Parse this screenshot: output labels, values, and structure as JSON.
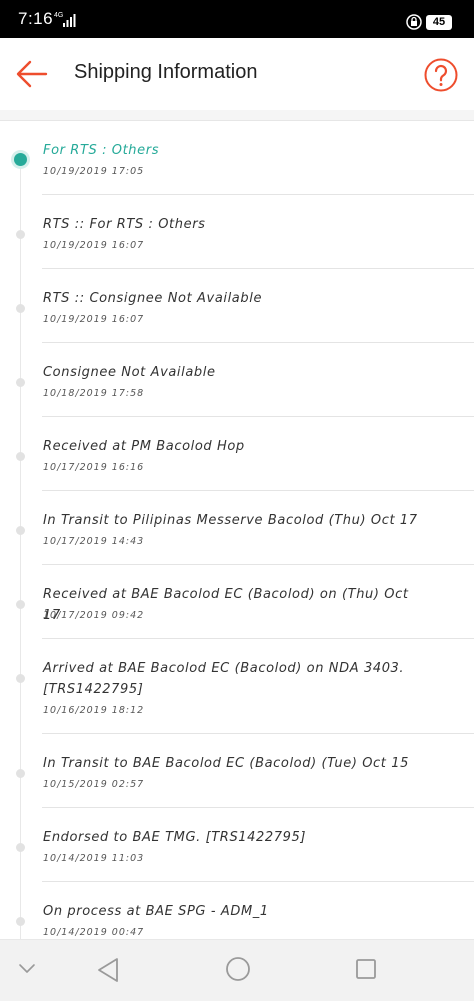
{
  "status_bar": {
    "time": "7:16",
    "network": "4G",
    "battery": "45"
  },
  "header": {
    "title": "Shipping Information"
  },
  "events": [
    {
      "status": "For RTS : Others",
      "time": "10/19/2019 17:05",
      "current": true
    },
    {
      "status": "RTS :: For RTS : Others",
      "time": "10/19/2019 16:07"
    },
    {
      "status": "RTS :: Consignee Not Available",
      "time": "10/19/2019 16:07"
    },
    {
      "status": "Consignee Not Available",
      "time": "10/18/2019 17:58"
    },
    {
      "status": "Received at PM Bacolod Hop",
      "time": "10/17/2019 16:16"
    },
    {
      "status": "In Transit to Pilipinas Messerve Bacolod (Thu) Oct 17",
      "time": "10/17/2019 14:43"
    },
    {
      "status": "Received at BAE Bacolod EC (Bacolod) on (Thu) Oct 17",
      "time": "10/17/2019 09:42"
    },
    {
      "status": "Arrived at BAE Bacolod EC (Bacolod) on NDA 3403. [TRS1422795]",
      "time": "10/16/2019 18:12"
    },
    {
      "status": "In Transit to BAE Bacolod EC (Bacolod) (Tue) Oct 15",
      "time": "10/15/2019 02:57"
    },
    {
      "status": "Endorsed to BAE TMG. [TRS1422795]",
      "time": "10/14/2019 11:03"
    },
    {
      "status": "On process at BAE SPG - ADM_1",
      "time": "10/14/2019 00:47"
    }
  ],
  "colors": {
    "accent": "#ee4d2d",
    "current": "#26aa99"
  }
}
